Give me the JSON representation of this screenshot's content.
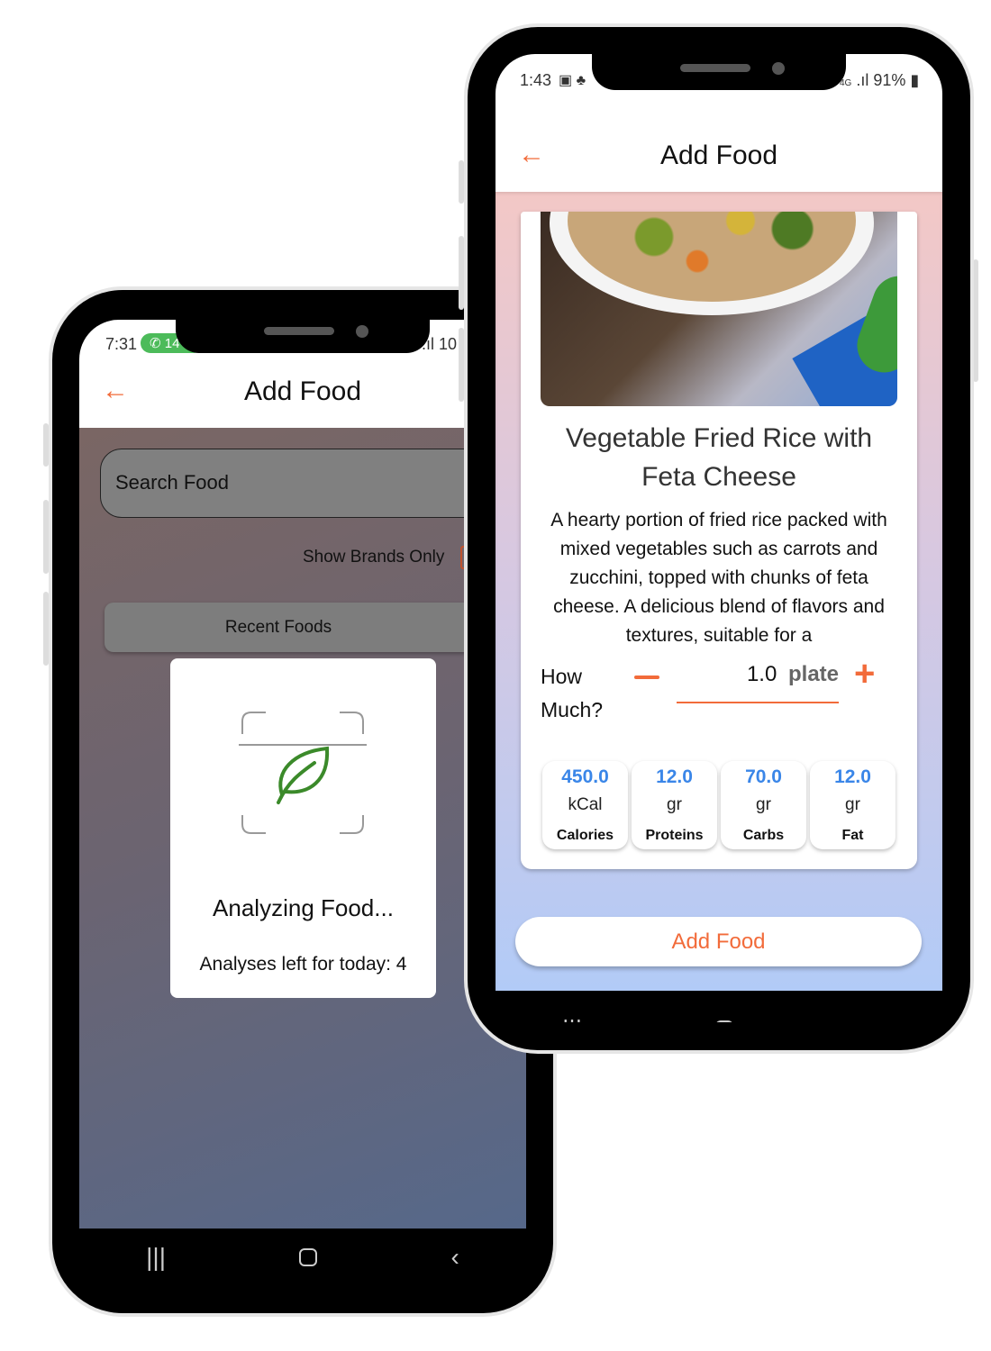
{
  "back_phone": {
    "status": {
      "time": "7:31",
      "call_badge": "14",
      "right": "10"
    },
    "header": {
      "title": "Add Food",
      "back_icon": "arrow-left-icon"
    },
    "search": {
      "placeholder": "Search Food"
    },
    "brands_toggle_label": "Show Brands Only",
    "recent_tab": "Recent Foods",
    "dialog": {
      "icon": "leaf-scan-icon",
      "title": "Analyzing Food...",
      "subtitle": "Analyses left for today: 4"
    }
  },
  "front_phone": {
    "status": {
      "time": "1:43",
      "network": "4G",
      "battery": "91%"
    },
    "header": {
      "title": "Add Food",
      "back_icon": "arrow-left-icon"
    },
    "food": {
      "title": "Vegetable Fried Rice with Feta Cheese",
      "description": "A hearty portion of fried rice packed with mixed vegetables such as carrots and zucchini, topped with chunks of feta cheese. A delicious blend of flavors and textures, suitable for a",
      "how_much_label": "How Much?",
      "quantity": "1.0",
      "unit": "plate",
      "nutrients": [
        {
          "value": "450.0",
          "unit": "kCal",
          "label": "Calories"
        },
        {
          "value": "12.0",
          "unit": "gr",
          "label": "Proteins"
        },
        {
          "value": "70.0",
          "unit": "gr",
          "label": "Carbs"
        },
        {
          "value": "12.0",
          "unit": "gr",
          "label": "Fat"
        }
      ]
    },
    "add_button": "Add Food"
  },
  "colors": {
    "accent": "#f26b3a",
    "nutrient_value": "#3a86e8"
  }
}
